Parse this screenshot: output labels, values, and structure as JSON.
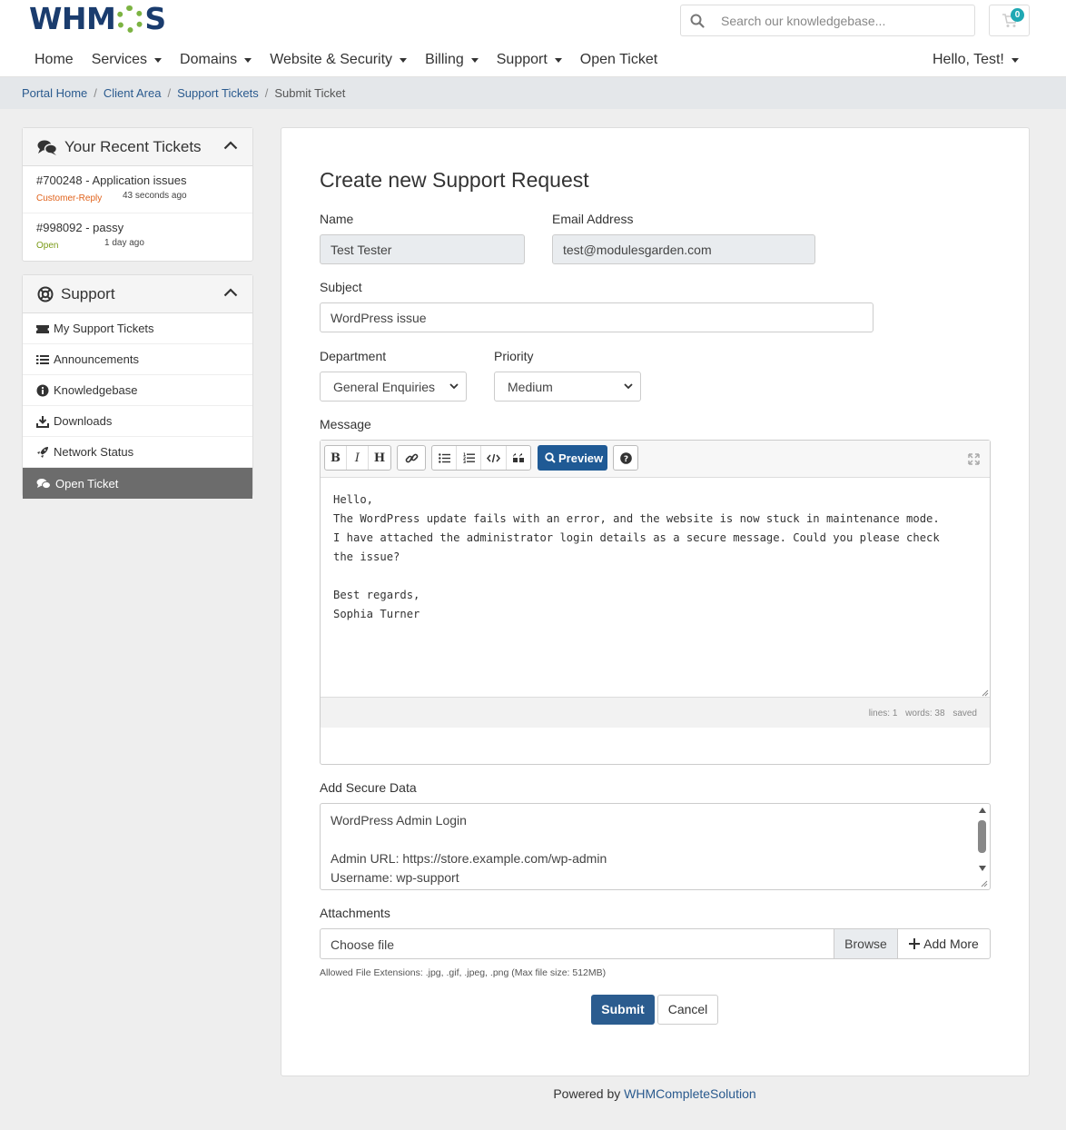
{
  "brand": {
    "logo_text_left": "WHM",
    "logo_text_right": "S"
  },
  "header": {
    "search_placeholder": "Search our knowledgebase...",
    "cart_count": "0",
    "nav": [
      "Home",
      "Services",
      "Domains",
      "Website & Security",
      "Billing",
      "Support",
      "Open Ticket"
    ],
    "user_greeting": "Hello, Test!"
  },
  "breadcrumb": {
    "items": [
      "Portal Home",
      "Client Area",
      "Support Tickets"
    ],
    "current": "Submit Ticket"
  },
  "recent_tickets": {
    "title": "Your Recent Tickets",
    "items": [
      {
        "title": "#700248 - Application issues",
        "status": "Customer-Reply",
        "time": "43 seconds ago",
        "status_color": "#e0621b"
      },
      {
        "title": "#998092 - passy",
        "status": "Open",
        "time": "1 day ago",
        "status_color": "#7a9a16"
      }
    ]
  },
  "support_menu": {
    "title": "Support",
    "items": [
      "My Support Tickets",
      "Announcements",
      "Knowledgebase",
      "Downloads",
      "Network Status",
      "Open Ticket"
    ],
    "active_index": 5
  },
  "form": {
    "heading": "Create new Support Request",
    "name_label": "Name",
    "name_value": "Test Tester",
    "email_label": "Email Address",
    "email_value": "test@modulesgarden.com",
    "subject_label": "Subject",
    "subject_value": "WordPress issue",
    "department_label": "Department",
    "department_value": "General Enquiries",
    "priority_label": "Priority",
    "priority_value": "Medium",
    "message_label": "Message",
    "preview_label": "Preview",
    "message_value": "Hello,\nThe WordPress update fails with an error, and the website is now stuck in maintenance mode.\nI have attached the administrator login details as a secure message. Could you please check\nthe issue?\n\nBest regards,\nSophia Turner",
    "status_lines": "lines: 1",
    "status_words": "words: 38",
    "status_saved": "saved",
    "secure_label": "Add Secure Data",
    "secure_value": "WordPress Admin Login\n\nAdmin URL: https://store.example.com/wp-admin\nUsername: wp-support",
    "attachments_label": "Attachments",
    "choose_file": "Choose file",
    "browse_label": "Browse",
    "add_more_label": "Add More",
    "allowed_ext": "Allowed File Extensions: .jpg, .gif, .jpeg, .png (Max file size: 512MB)",
    "submit_label": "Submit",
    "cancel_label": "Cancel"
  },
  "footer": {
    "powered_by": "Powered by",
    "link": "WHMCompleteSolution"
  },
  "colors": {
    "primary": "#2b5c8f",
    "link": "#2a5a8e",
    "accent_badge": "#1fa8b3"
  }
}
